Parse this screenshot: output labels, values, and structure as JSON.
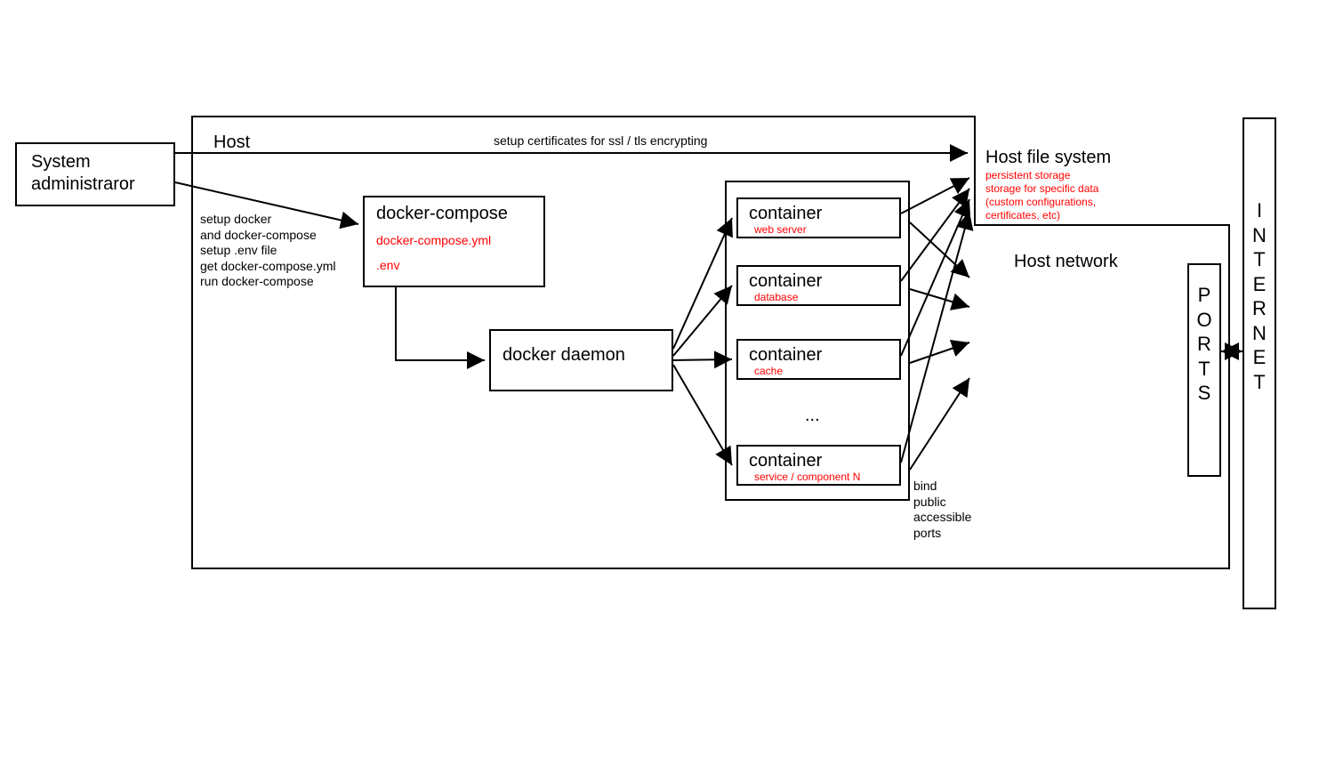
{
  "actor": {
    "label": "System\nadministraror"
  },
  "host": {
    "label": "Host"
  },
  "admin_steps": "setup docker\nand docker-compose\nsetup .env file\nget docker-compose.yml\nrun docker-compose",
  "ssl_label": "setup certificates for ssl / tls encrypting",
  "compose": {
    "title": "docker-compose",
    "file1": "docker-compose.yml",
    "file2": ".env"
  },
  "daemon": {
    "title": "docker daemon"
  },
  "containers": {
    "title": "container",
    "services": [
      "web server",
      "database",
      "cache",
      "service / component N"
    ],
    "ellipsis": "..."
  },
  "fs": {
    "title": "Host file system",
    "notes": "persistent storage\nstorage for specific data\n(custom configurations,\ncertificates, etc)"
  },
  "network": {
    "title": "Host network"
  },
  "ports": {
    "label": "PORTS",
    "bind_note": "bind\npublic\naccessible\nports"
  },
  "internet": {
    "label": "INTERNET"
  }
}
